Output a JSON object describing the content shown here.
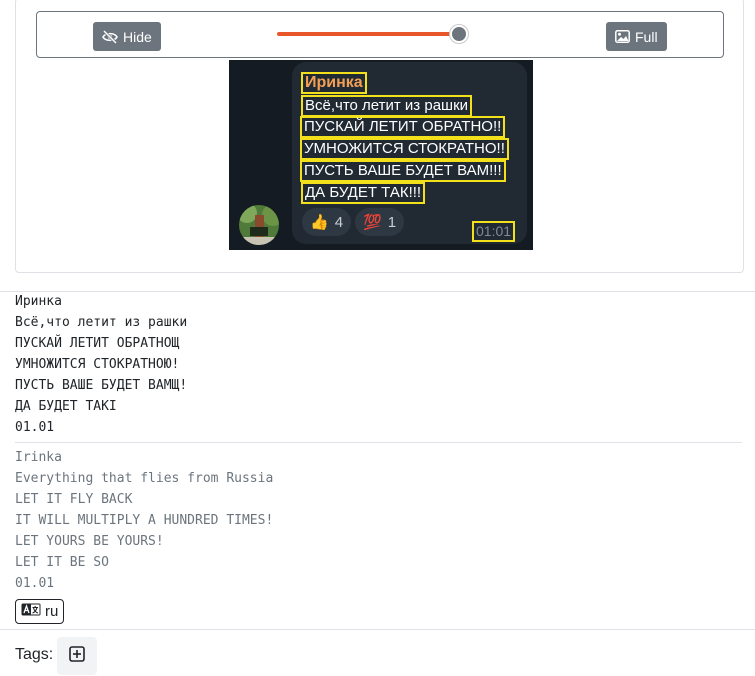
{
  "toolbar": {
    "hide_label": "Hide",
    "full_label": "Full",
    "slider_value": 0.91
  },
  "message": {
    "sender": "Иринка",
    "lines": [
      "Всё,что летит из рашки",
      "ПУСКАЙ ЛЕТИТ ОБРАТНО!!",
      "УМНОЖИТСЯ СТОКРАТНО!!",
      "ПУСТЬ ВАШЕ БУДЕТ ВАМ!!!",
      "ДА БУДЕТ ТАК!!!"
    ],
    "reactions": [
      {
        "emoji": "👍",
        "count": "4"
      },
      {
        "emoji": "💯",
        "count": "1"
      }
    ],
    "time": "01:01"
  },
  "ocr_original": [
    "Иринка",
    "Всё,что летит из рашки",
    "ПУСКАЙ ЛЕТИТ ОБРАТНОЩ",
    "УМНОЖИТСЯ СТОКРАТНОЮ!",
    "ПУСТЬ ВАШЕ БУДЕТ ВАМЩ!",
    "ДА БУДЕТ ТАКI",
    "01.01"
  ],
  "ocr_translation": [
    "Irinka",
    "Everything that flies from Russia",
    "LET IT FLY BACK",
    "IT WILL MULTIPLY A HUNDRED TIMES!",
    "LET YOURS BE YOURS!",
    "LET IT BE SO",
    "01.01"
  ],
  "language": "ru",
  "tags_label": "Tags:",
  "colors": {
    "accent_slider": "#e8572a",
    "button_gray": "#6c757d",
    "highlight_box": "#f1e01a",
    "chat_bg": "#151b22",
    "bubble_bg": "#212a33",
    "sender_color": "#f2a154"
  },
  "icons": {
    "hide": "eye-slash-icon",
    "full": "image-icon",
    "language": "translate-icon",
    "add_tag": "plus-square-icon"
  }
}
